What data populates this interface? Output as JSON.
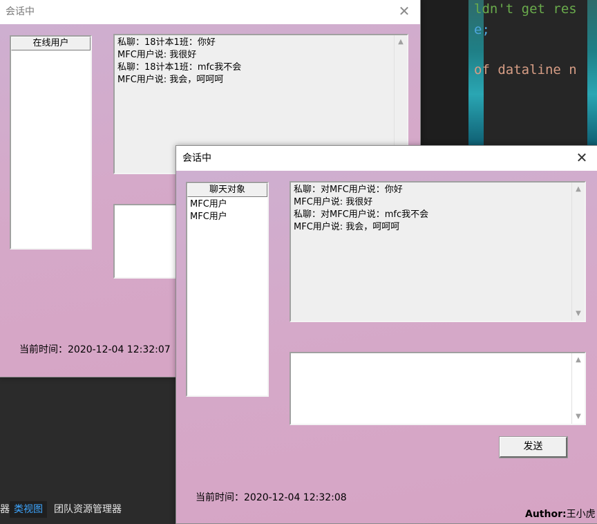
{
  "background": {
    "code_lines": [
      {
        "text": "ldn't get res",
        "color": "#6aab4c"
      },
      {
        "text": "e;",
        "color": "#4ea6dd"
      },
      {
        "text": "of dataline n",
        "color": "#d69d85"
      }
    ],
    "taskbar_tabs": [
      "器",
      "类视图",
      "团队资源管理器"
    ]
  },
  "window_back": {
    "title": "会话中",
    "user_list_header": "在线用户",
    "user_list_items": [],
    "chat_lines": [
      "私聊：18计本1班：你好",
      "MFC用户说: 我很好",
      "私聊：18计本1班：mfc我不会",
      "MFC用户说: 我会，呵呵呵"
    ],
    "time_label": "当前时间：2020-12-04 12:32:07"
  },
  "window_front": {
    "title": "会话中",
    "chat_target_header": "聊天对象",
    "chat_target_items": [
      "MFC用户",
      "MFC用户"
    ],
    "chat_lines": [
      "私聊：对MFC用户说：你好",
      "MFC用户说: 我很好",
      "私聊：对MFC用户说：mfc我不会",
      "MFC用户说: 我会，呵呵呵"
    ],
    "input_value": "",
    "send_label": "发送",
    "time_label": "当前时间：2020-12-04 12:32:08",
    "author_label": "Author:",
    "author_name": "王小虎"
  }
}
